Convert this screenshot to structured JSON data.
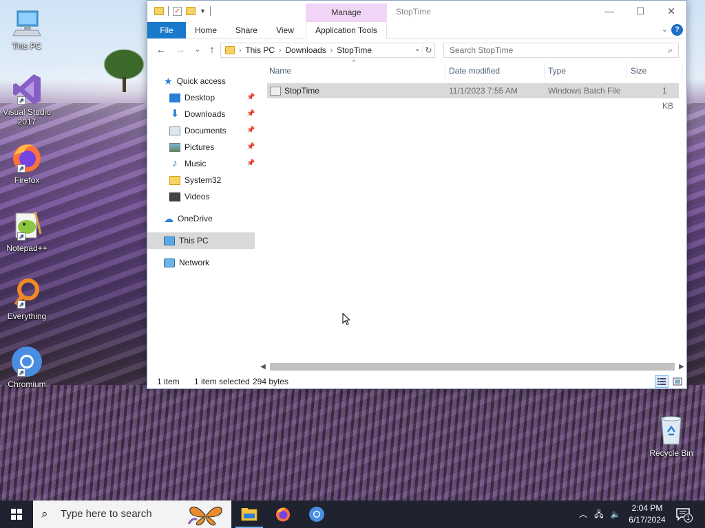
{
  "desktop": {
    "icons": [
      {
        "label": "This PC"
      },
      {
        "label": "Visual Studio 2017"
      },
      {
        "label": "Firefox"
      },
      {
        "label": "Notepad++"
      },
      {
        "label": "Everything"
      },
      {
        "label": "Chromium"
      },
      {
        "label": "Recycle Bin"
      }
    ]
  },
  "window": {
    "title": "StopTime",
    "context_tab": "Manage",
    "ribbon_tabs": [
      "File",
      "Home",
      "Share",
      "View",
      "Application Tools"
    ],
    "help": "?",
    "address": {
      "crumbs": [
        "This PC",
        "Downloads",
        "StopTime"
      ]
    },
    "search_placeholder": "Search StopTime",
    "nav": {
      "quick_access": "Quick access",
      "items": [
        "Desktop",
        "Downloads",
        "Documents",
        "Pictures",
        "Music",
        "System32",
        "Videos"
      ],
      "onedrive": "OneDrive",
      "this_pc": "This PC",
      "network": "Network"
    },
    "columns": {
      "name": "Name",
      "date": "Date modified",
      "type": "Type",
      "size": "Size"
    },
    "files": [
      {
        "name": "StopTime",
        "date": "11/1/2023 7:55 AM",
        "type": "Windows Batch File",
        "size": "1 KB"
      }
    ],
    "status": {
      "count": "1 item",
      "selected": "1 item selected",
      "bytes": "294 bytes"
    }
  },
  "taskbar": {
    "search_placeholder": "Type here to search",
    "time": "2:04 PM",
    "date": "6/17/2024",
    "notification_count": "1"
  },
  "colors": {
    "accent": "#1979ca",
    "selection": "#d9d9d9",
    "context_tab": "#f1d5f6",
    "taskbar": "#1f2330"
  }
}
